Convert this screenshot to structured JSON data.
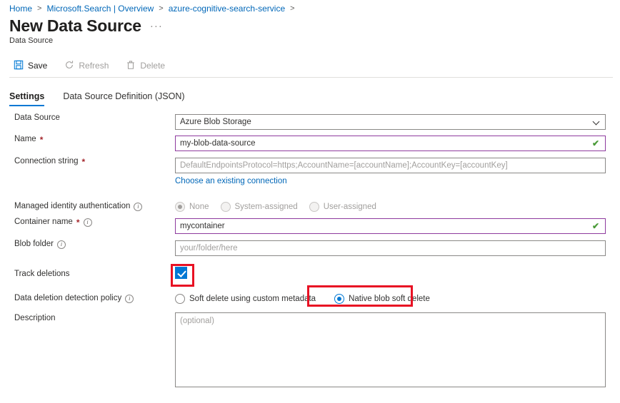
{
  "breadcrumb": {
    "items": [
      {
        "label": "Home",
        "type": "link"
      },
      {
        "label": "Microsoft.Search | Overview",
        "type": "link"
      },
      {
        "label": "azure-cognitive-search-service",
        "type": "link"
      }
    ],
    "separator": ">"
  },
  "header": {
    "title": "New Data Source",
    "subtitle": "Data Source",
    "ellipsis": "···"
  },
  "toolbar": {
    "save_label": "Save",
    "refresh_label": "Refresh",
    "delete_label": "Delete"
  },
  "tabs": [
    {
      "label": "Settings",
      "active": true
    },
    {
      "label": "Data Source Definition (JSON)",
      "active": false
    }
  ],
  "form": {
    "data_source": {
      "label": "Data Source",
      "value": "Azure Blob Storage",
      "options": [
        "Azure Blob Storage"
      ]
    },
    "name": {
      "label": "Name",
      "required": "*",
      "value": "my-blob-data-source",
      "valid": true,
      "validation_glyph": "✔"
    },
    "connection_string": {
      "label": "Connection string",
      "required": "*",
      "placeholder": "DefaultEndpointsProtocol=https;AccountName=[accountName];AccountKey=[accountKey]",
      "link_label": "Choose an existing connection"
    },
    "managed_identity": {
      "label": "Managed identity authentication",
      "options": [
        {
          "label": "None",
          "selected": true
        },
        {
          "label": "System-assigned",
          "selected": false
        },
        {
          "label": "User-assigned",
          "selected": false
        }
      ]
    },
    "container_name": {
      "label": "Container name",
      "required": "*",
      "value": "mycontainer",
      "valid": true,
      "validation_glyph": "✔"
    },
    "blob_folder": {
      "label": "Blob folder",
      "placeholder": "your/folder/here"
    },
    "track_deletions": {
      "label": "Track deletions",
      "checked": true,
      "highlighted": true
    },
    "deletion_policy": {
      "label": "Data deletion detection policy",
      "options": [
        {
          "label": "Soft delete using custom metadata",
          "selected": false,
          "highlighted": false
        },
        {
          "label": "Native blob soft delete",
          "selected": true,
          "highlighted": true
        }
      ]
    },
    "description": {
      "label": "Description",
      "placeholder": "(optional)"
    }
  },
  "colors": {
    "accent": "#0078d4",
    "link": "#0067b8",
    "required": "#a4262c",
    "valid_border": "#8e3a9e",
    "valid_check": "#4a9b38",
    "annotation": "#e81123"
  }
}
